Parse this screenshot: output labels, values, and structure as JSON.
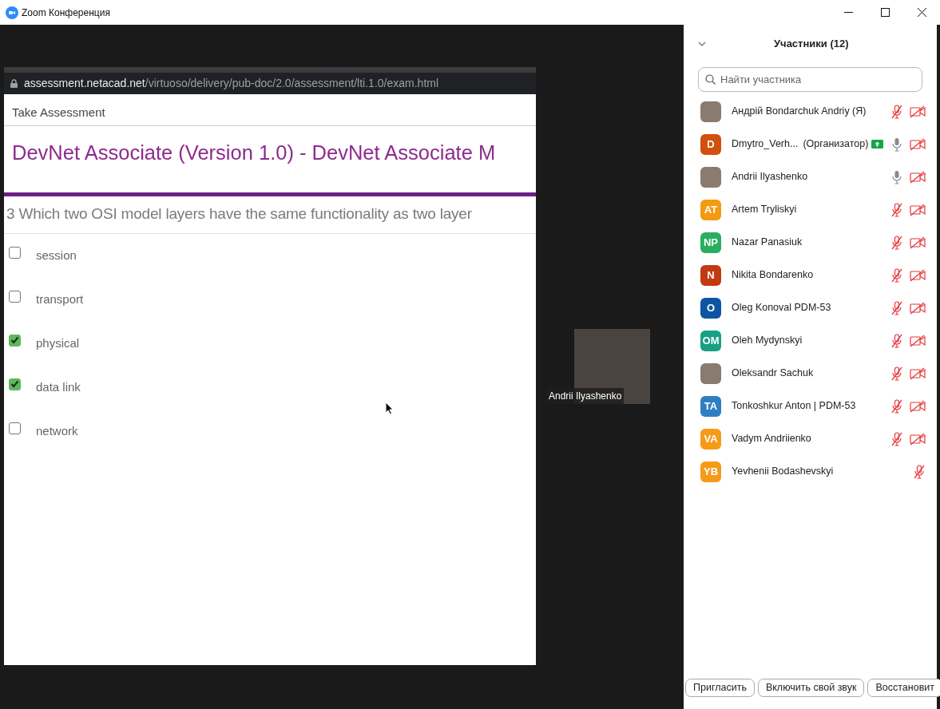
{
  "window": {
    "title": "Zoom Конференция"
  },
  "shared_screen": {
    "url_host": "assessment.netacad.net",
    "url_path": "/virtuoso/delivery/pub-doc/2.0/assessment/lti.1.0/exam.html",
    "page_header": "Take Assessment",
    "exam_title": "DevNet Associate (Version 1.0) - DevNet Associate M",
    "question_number": "3",
    "question_text": "Which two OSI model layers have the same functionality as two layer",
    "options": [
      {
        "label": "session",
        "checked": false
      },
      {
        "label": "transport",
        "checked": false
      },
      {
        "label": "physical",
        "checked": true
      },
      {
        "label": "data link",
        "checked": true
      },
      {
        "label": "network",
        "checked": false
      }
    ]
  },
  "video_tile": {
    "name": "Andrii Ilyashenko"
  },
  "participants_panel": {
    "title": "Участники (12)",
    "search": {
      "placeholder": "Найти участника"
    },
    "participants": [
      {
        "name": "Андрій Bondarchuk Andriy (Я)",
        "kind": "photo",
        "muted": true,
        "video_off": true,
        "sharing": false
      },
      {
        "name": "Dmytro_Verh...",
        "role": "(Организатор)",
        "kind": "initials",
        "initials": "D",
        "color": "#d2500f",
        "muted": false,
        "video_off": true,
        "sharing": true
      },
      {
        "name": "Andrii Ilyashenko",
        "kind": "photo",
        "muted": false,
        "video_off": true,
        "sharing": false
      },
      {
        "name": "Artem Tryliskyi",
        "kind": "initials",
        "initials": "AT",
        "color": "#f39a12",
        "muted": true,
        "video_off": true,
        "sharing": false
      },
      {
        "name": "Nazar Panasiuk",
        "kind": "initials",
        "initials": "NP",
        "color": "#27ae5f",
        "muted": true,
        "video_off": true,
        "sharing": false
      },
      {
        "name": "Nikita Bondarenko",
        "kind": "initials",
        "initials": "N",
        "color": "#c23a14",
        "muted": true,
        "video_off": true,
        "sharing": false
      },
      {
        "name": "Oleg Konoval PDM-53",
        "kind": "initials",
        "initials": "O",
        "color": "#0d55a3",
        "muted": true,
        "video_off": true,
        "sharing": false
      },
      {
        "name": "Oleh Mydynskyi",
        "kind": "initials",
        "initials": "OM",
        "color": "#18a083",
        "muted": true,
        "video_off": true,
        "sharing": false
      },
      {
        "name": "Oleksandr Sachuk",
        "kind": "photo",
        "muted": true,
        "video_off": true,
        "sharing": false
      },
      {
        "name": "Tonkoshkur Anton | PDM-53",
        "kind": "initials",
        "initials": "TA",
        "color": "#2e7fc1",
        "muted": true,
        "video_off": true,
        "sharing": false
      },
      {
        "name": "Vadym Andriienko",
        "kind": "initials",
        "initials": "VA",
        "color": "#f59b18",
        "muted": true,
        "video_off": true,
        "sharing": false
      },
      {
        "name": "Yevhenii Bodashevskyi",
        "kind": "initials",
        "initials": "YB",
        "color": "#f59b18",
        "muted": true,
        "video_off": false,
        "sharing": false
      }
    ],
    "buttons": [
      "Пригласить",
      "Включить свой звук",
      "Восстановит"
    ]
  }
}
